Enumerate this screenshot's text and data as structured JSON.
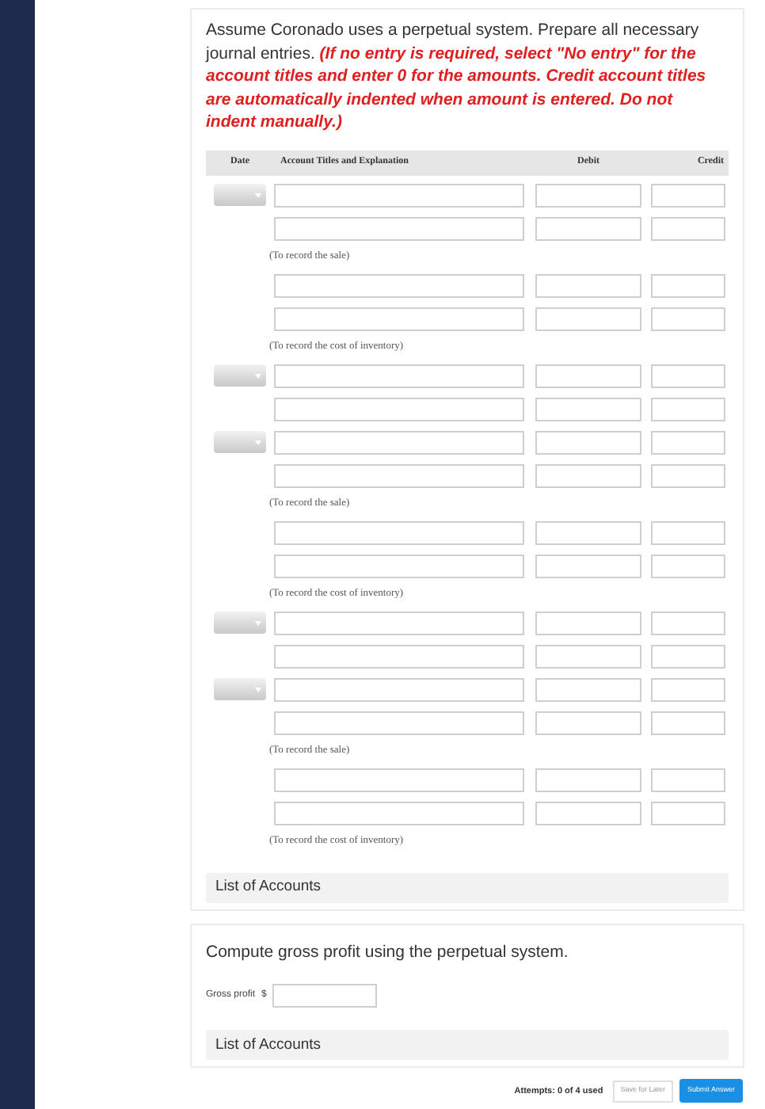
{
  "question": {
    "intro": "Assume Coronado uses a perpetual system. Prepare all necessary journal entries.",
    "instruction": "(If no entry is required, select \"No entry\" for the account titles and enter 0 for the amounts. Credit account titles are automatically indented when amount is entered. Do not indent manually.)"
  },
  "table": {
    "columns": [
      "Date",
      "Account Titles and Explanation",
      "Debit",
      "Credit"
    ],
    "lines": [
      {
        "kind": "date-line"
      },
      {
        "kind": "line"
      },
      {
        "kind": "explanation",
        "text": "(To record the sale)"
      },
      {
        "kind": "line"
      },
      {
        "kind": "line"
      },
      {
        "kind": "explanation",
        "text": "(To record the cost of inventory)"
      },
      {
        "kind": "date-line"
      },
      {
        "kind": "line"
      },
      {
        "kind": "date-line"
      },
      {
        "kind": "line"
      },
      {
        "kind": "explanation",
        "text": "(To record the sale)"
      },
      {
        "kind": "line"
      },
      {
        "kind": "line"
      },
      {
        "kind": "explanation",
        "text": "(To record the cost of inventory)"
      },
      {
        "kind": "date-line"
      },
      {
        "kind": "line"
      },
      {
        "kind": "date-line"
      },
      {
        "kind": "line"
      },
      {
        "kind": "explanation",
        "text": "(To record the sale)"
      },
      {
        "kind": "line"
      },
      {
        "kind": "line"
      },
      {
        "kind": "explanation",
        "text": "(To record the cost of inventory)"
      }
    ]
  },
  "list_of_accounts_1": "List of Accounts",
  "gross_profit": {
    "title": "Compute gross profit using the perpetual system.",
    "label": "Gross profit",
    "currency": "$"
  },
  "list_of_accounts_2": "List of Accounts",
  "footer": {
    "attempts": "Attempts: 0 of 4 used",
    "save": "Save for Later",
    "submit": "Submit Answer"
  }
}
